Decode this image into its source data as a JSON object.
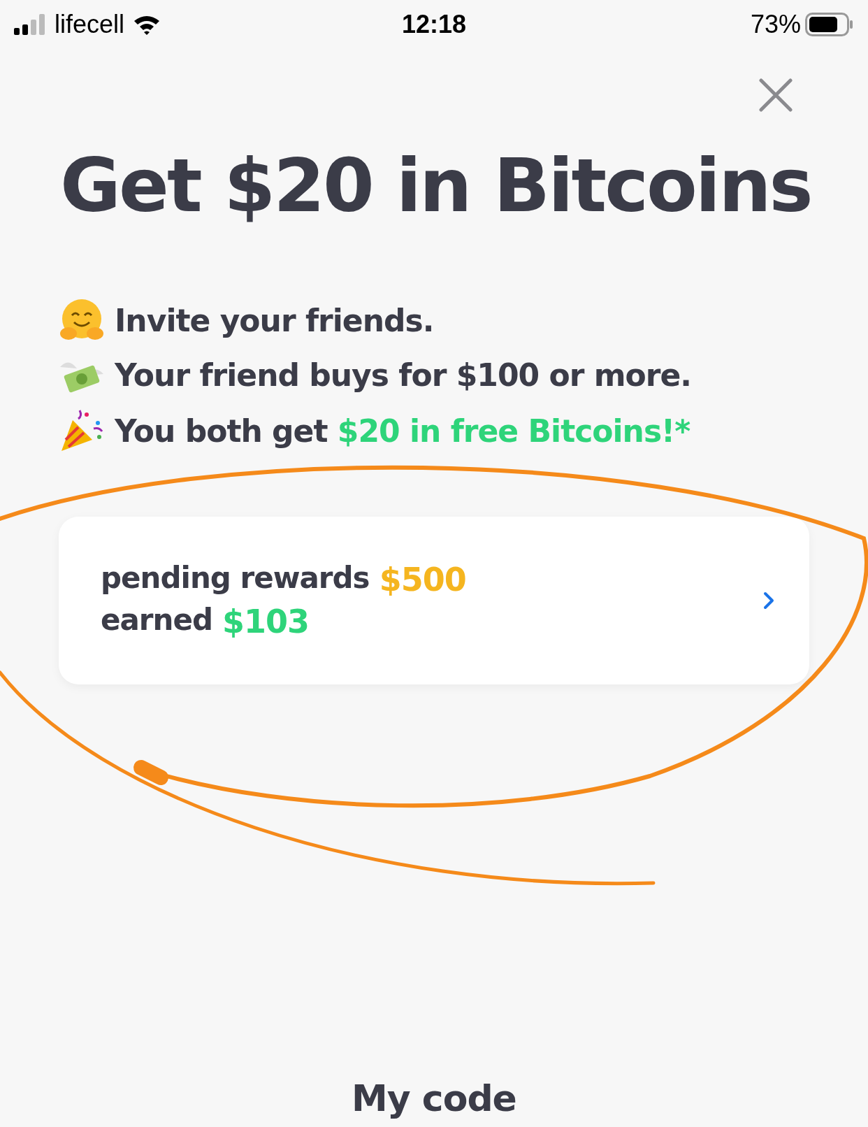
{
  "status_bar": {
    "carrier": "lifecell",
    "time": "12:18",
    "battery": "73%"
  },
  "title": "Get $20 in Bitcoins",
  "steps": [
    {
      "kind": "hug",
      "text": "Invite your friends."
    },
    {
      "kind": "money",
      "text": "Your friend buys for $100 or more."
    },
    {
      "kind": "party",
      "text": "You both get ",
      "highlight": "$20 in free Bitcoins!*"
    }
  ],
  "rewards_card": {
    "lines": [
      {
        "label": "pending rewards",
        "value": "$500",
        "color": "#f5b51f"
      },
      {
        "label": "earned",
        "value": "$103",
        "color": "#2ed47a"
      }
    ]
  },
  "footer": {
    "label": "My code"
  }
}
